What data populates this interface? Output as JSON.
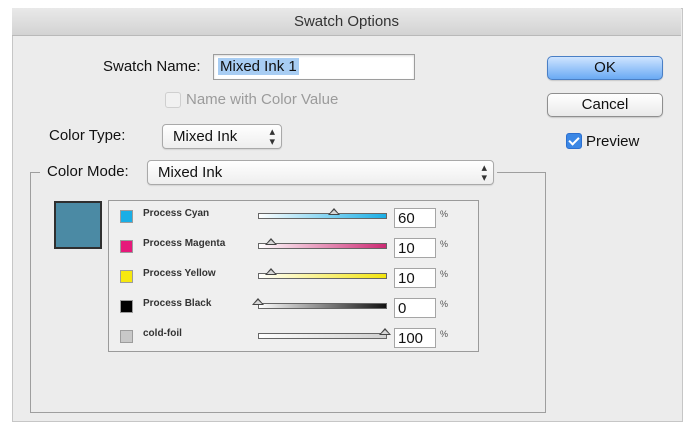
{
  "window": {
    "title": "Swatch Options"
  },
  "form": {
    "swatch_name_label": "Swatch Name:",
    "swatch_name_value": "Mixed Ink 1",
    "name_with_color_value_label": "Name with Color Value",
    "color_type_label": "Color Type:",
    "color_type_value": "Mixed Ink",
    "color_mode_label": "Color Mode:",
    "color_mode_value": "Mixed Ink"
  },
  "buttons": {
    "ok": "OK",
    "cancel": "Cancel"
  },
  "preview": {
    "label": "Preview",
    "checked": true
  },
  "swatch_color": "#4b8aa4",
  "inks": [
    {
      "name": "Process Cyan",
      "value": "60",
      "level": 0.6,
      "color": "#1aaee5",
      "grad_end": "#1aaee5"
    },
    {
      "name": "Process Magenta",
      "value": "10",
      "level": 0.1,
      "color": "#e5197a",
      "grad_end": "#cc2a73"
    },
    {
      "name": "Process Yellow",
      "value": "10",
      "level": 0.1,
      "color": "#f6e80f",
      "grad_end": "#f2e40e"
    },
    {
      "name": "Process Black",
      "value": "0",
      "level": 0.0,
      "color": "#000000",
      "grad_end": "#111111"
    },
    {
      "name": "cold-foil",
      "value": "100",
      "level": 1.0,
      "color": "#c8c8c8",
      "grad_end": "#d0d0d0"
    }
  ],
  "percent_symbol": "%"
}
